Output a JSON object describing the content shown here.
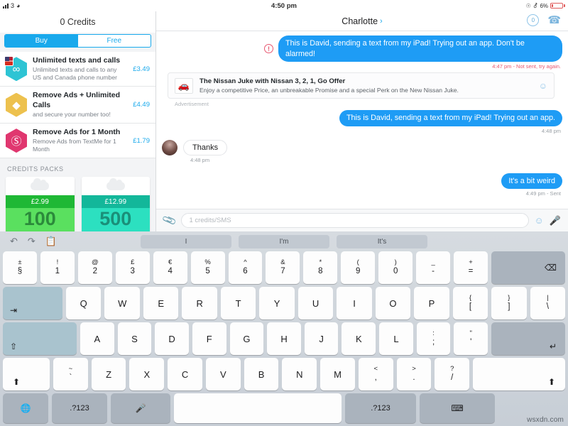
{
  "status_bar": {
    "signal_label": "3",
    "wifi_icon": "wifi-icon",
    "time": "4:50 pm",
    "lock_icon": "rotation-lock-icon",
    "bluetooth_icon": "bluetooth-icon",
    "battery_percent": "6%"
  },
  "sidebar": {
    "credits_title": "0 Credits",
    "tabs": [
      {
        "label": "Buy",
        "active": true
      },
      {
        "label": "Free",
        "active": false
      }
    ],
    "offers": [
      {
        "title": "Unlimited texts and calls",
        "subtitle": "Unlimited texts and calls to any US and Canada phone number",
        "price": "£3.49",
        "icon": "infinity-hex-icon"
      },
      {
        "title": "Remove Ads + Unlimited Calls",
        "subtitle": "and secure your number too!",
        "price": "£4.49",
        "icon": "diamond-hex-icon"
      },
      {
        "title": "Remove Ads for 1 Month",
        "subtitle": "Remove Ads from TextMe for 1 Month",
        "price": "£1.79",
        "icon": "no-ads-hex-icon"
      }
    ],
    "packs_label": "CREDITS PACKS",
    "packs": [
      {
        "price": "£2.99",
        "amount": "100",
        "icon": "cloud-icon"
      },
      {
        "price": "£12.99",
        "amount": "500",
        "icon": "cloud-icon"
      }
    ]
  },
  "chat": {
    "contact_name": "Charlotte",
    "chevron": "›",
    "credits_badge": "0",
    "call_icon": "phone-icon",
    "messages": [
      {
        "direction": "out",
        "text": "This is David, sending a text from my iPad! Trying out an app. Don't be alarmed!",
        "meta": "4:47 pm - Not sent, try again.",
        "error": true
      },
      {
        "direction": "ad",
        "title": "The Nissan Juke with Nissan 3, 2, 1, Go Offer",
        "subtitle": "Enjoy a competitive Price, an unbreakable Promise and a special Perk on the New Nissan Juke.",
        "label": "Advertisement",
        "thumb_icon": "car-icon",
        "action_icon": "smiley-icon"
      },
      {
        "direction": "out",
        "text": "This is David, sending a text from my iPad! Trying out an app.",
        "meta": "4:48 pm",
        "error": false
      },
      {
        "direction": "in",
        "text": "Thanks",
        "meta": "4:48 pm",
        "avatar": "contact-avatar"
      },
      {
        "direction": "out",
        "text": "It's a bit weird",
        "meta": "4:49 pm - Sent",
        "error": false
      }
    ],
    "composer": {
      "attach_icon": "paperclip-icon",
      "placeholder": "1 credits/SMS",
      "value": "",
      "emoji_icon": "smiley-icon",
      "mic_icon": "microphone-icon"
    }
  },
  "keyboard": {
    "undo_icon": "undo-icon",
    "redo_icon": "redo-icon",
    "paste_icon": "clipboard-icon",
    "predictions": [
      "I",
      "I'm",
      "It's"
    ],
    "row_numbers": [
      {
        "top": "±",
        "bot": "§"
      },
      {
        "top": "!",
        "bot": "1"
      },
      {
        "top": "@",
        "bot": "2"
      },
      {
        "top": "£",
        "bot": "3"
      },
      {
        "top": "€",
        "bot": "4"
      },
      {
        "top": "%",
        "bot": "5"
      },
      {
        "top": "^",
        "bot": "6"
      },
      {
        "top": "&",
        "bot": "7"
      },
      {
        "top": "*",
        "bot": "8"
      },
      {
        "top": "(",
        "bot": "9"
      },
      {
        "top": ")",
        "bot": "0"
      },
      {
        "top": "_",
        "bot": "-"
      },
      {
        "top": "+",
        "bot": "="
      }
    ],
    "backspace_icon": "backspace-icon",
    "tab_icon": "tab-icon",
    "row_q": [
      "Q",
      "W",
      "E",
      "R",
      "T",
      "Y",
      "U",
      "I",
      "O",
      "P"
    ],
    "row_q_extra": [
      {
        "top": "{",
        "bot": "["
      },
      {
        "top": "}",
        "bot": "]"
      },
      {
        "top": "|",
        "bot": "\\"
      }
    ],
    "capslock_icon": "capslock-icon",
    "row_a": [
      "A",
      "S",
      "D",
      "F",
      "G",
      "H",
      "J",
      "K",
      "L"
    ],
    "row_a_extra": [
      {
        "top": ":",
        "bot": ";"
      },
      {
        "top": "\"",
        "bot": "'"
      }
    ],
    "return_icon": "return-icon",
    "shift_icon": "shift-icon",
    "row_z_first": {
      "top": "~",
      "bot": "`"
    },
    "row_z": [
      "Z",
      "X",
      "C",
      "V",
      "B",
      "N",
      "M"
    ],
    "row_z_extra": [
      {
        "top": "<",
        "bot": ","
      },
      {
        "top": ">",
        "bot": "."
      },
      {
        "top": "?",
        "bot": "/"
      }
    ],
    "globe_icon": "globe-icon",
    "numeric_label_left": ".?123",
    "dictation_icon": "microphone-icon",
    "space_label": "",
    "numeric_label_right": ".?123",
    "dismiss_icon": "hide-keyboard-icon"
  },
  "watermark": "wsxdn.com",
  "colors": {
    "accent_blue": "#19a9ec",
    "bubble_blue": "#1e9cf5",
    "error_red": "#e8566f",
    "pack_green": "#1fb835",
    "pack_teal": "#13b79a"
  }
}
